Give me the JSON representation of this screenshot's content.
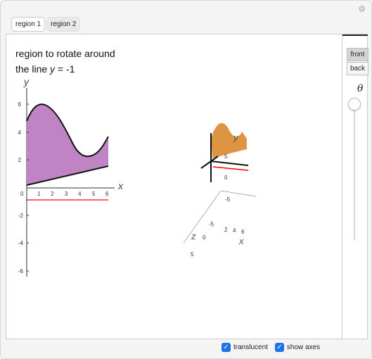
{
  "window": {
    "close_glyph": "×"
  },
  "tabs": [
    {
      "label": "region 1",
      "active": true
    },
    {
      "label": "region 2",
      "active": false
    }
  ],
  "title": {
    "line1": "region to rotate around",
    "line2_prefix": "the line ",
    "line2_var": "y",
    "line2_suffix": " = -1"
  },
  "plot2d": {
    "y_axis_label": "y",
    "x_axis_label": "x",
    "y_ticks": [
      "6",
      "4",
      "2",
      "-2",
      "-4",
      "-6"
    ],
    "x_ticks": [
      "0",
      "1",
      "2",
      "3",
      "4",
      "5",
      "6"
    ],
    "fill_color": "#c084c4",
    "line_color": "#ff0000"
  },
  "plot3d": {
    "labels": {
      "y": "y",
      "z": "z",
      "x": "x"
    },
    "ticks": {
      "y_top": "5",
      "y_mid": "0",
      "y_neg": "-5",
      "z_neg": "-5",
      "z_zero": "0",
      "z_pos": "5",
      "x_2": "2",
      "x_4": "4",
      "x_6": "6"
    },
    "fill_color": "#d98a30"
  },
  "controls": {
    "view_front": "front",
    "view_back": "back",
    "theta_label": "θ",
    "theta_value": 0
  },
  "options": {
    "translucent_label": "translucent",
    "translucent_checked": true,
    "show_axes_label": "show axes",
    "show_axes_checked": true
  }
}
